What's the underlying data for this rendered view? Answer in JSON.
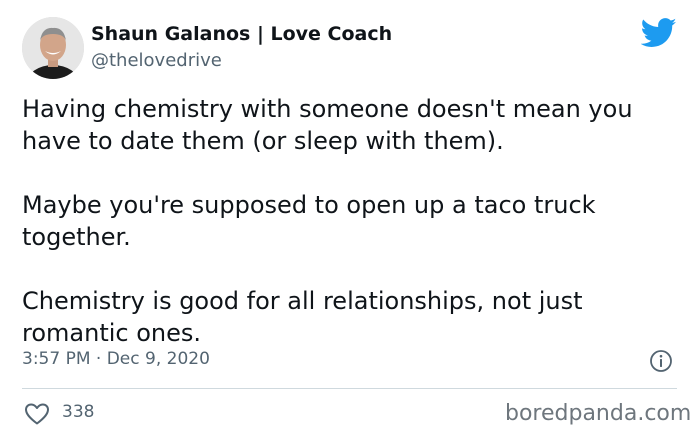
{
  "author": {
    "display_name": "Shaun Galanos | Love Coach",
    "handle": "@thelovedrive"
  },
  "tweet": {
    "paragraphs": [
      "Having chemistry with someone doesn't mean you have to date them (or sleep with them).",
      "Maybe you're supposed to open up a taco truck together.",
      "Chemistry is good for all relationships, not just romantic ones."
    ],
    "timestamp": "3:57 PM · Dec 9, 2020",
    "like_count": "338"
  },
  "icons": {
    "brand": "twitter-bird-icon",
    "info": "info-icon",
    "like": "heart-icon"
  },
  "watermark": "boredpanda.com",
  "colors": {
    "twitter_blue": "#1d9bf0",
    "text_primary": "#0f1419",
    "text_secondary": "#536471"
  }
}
